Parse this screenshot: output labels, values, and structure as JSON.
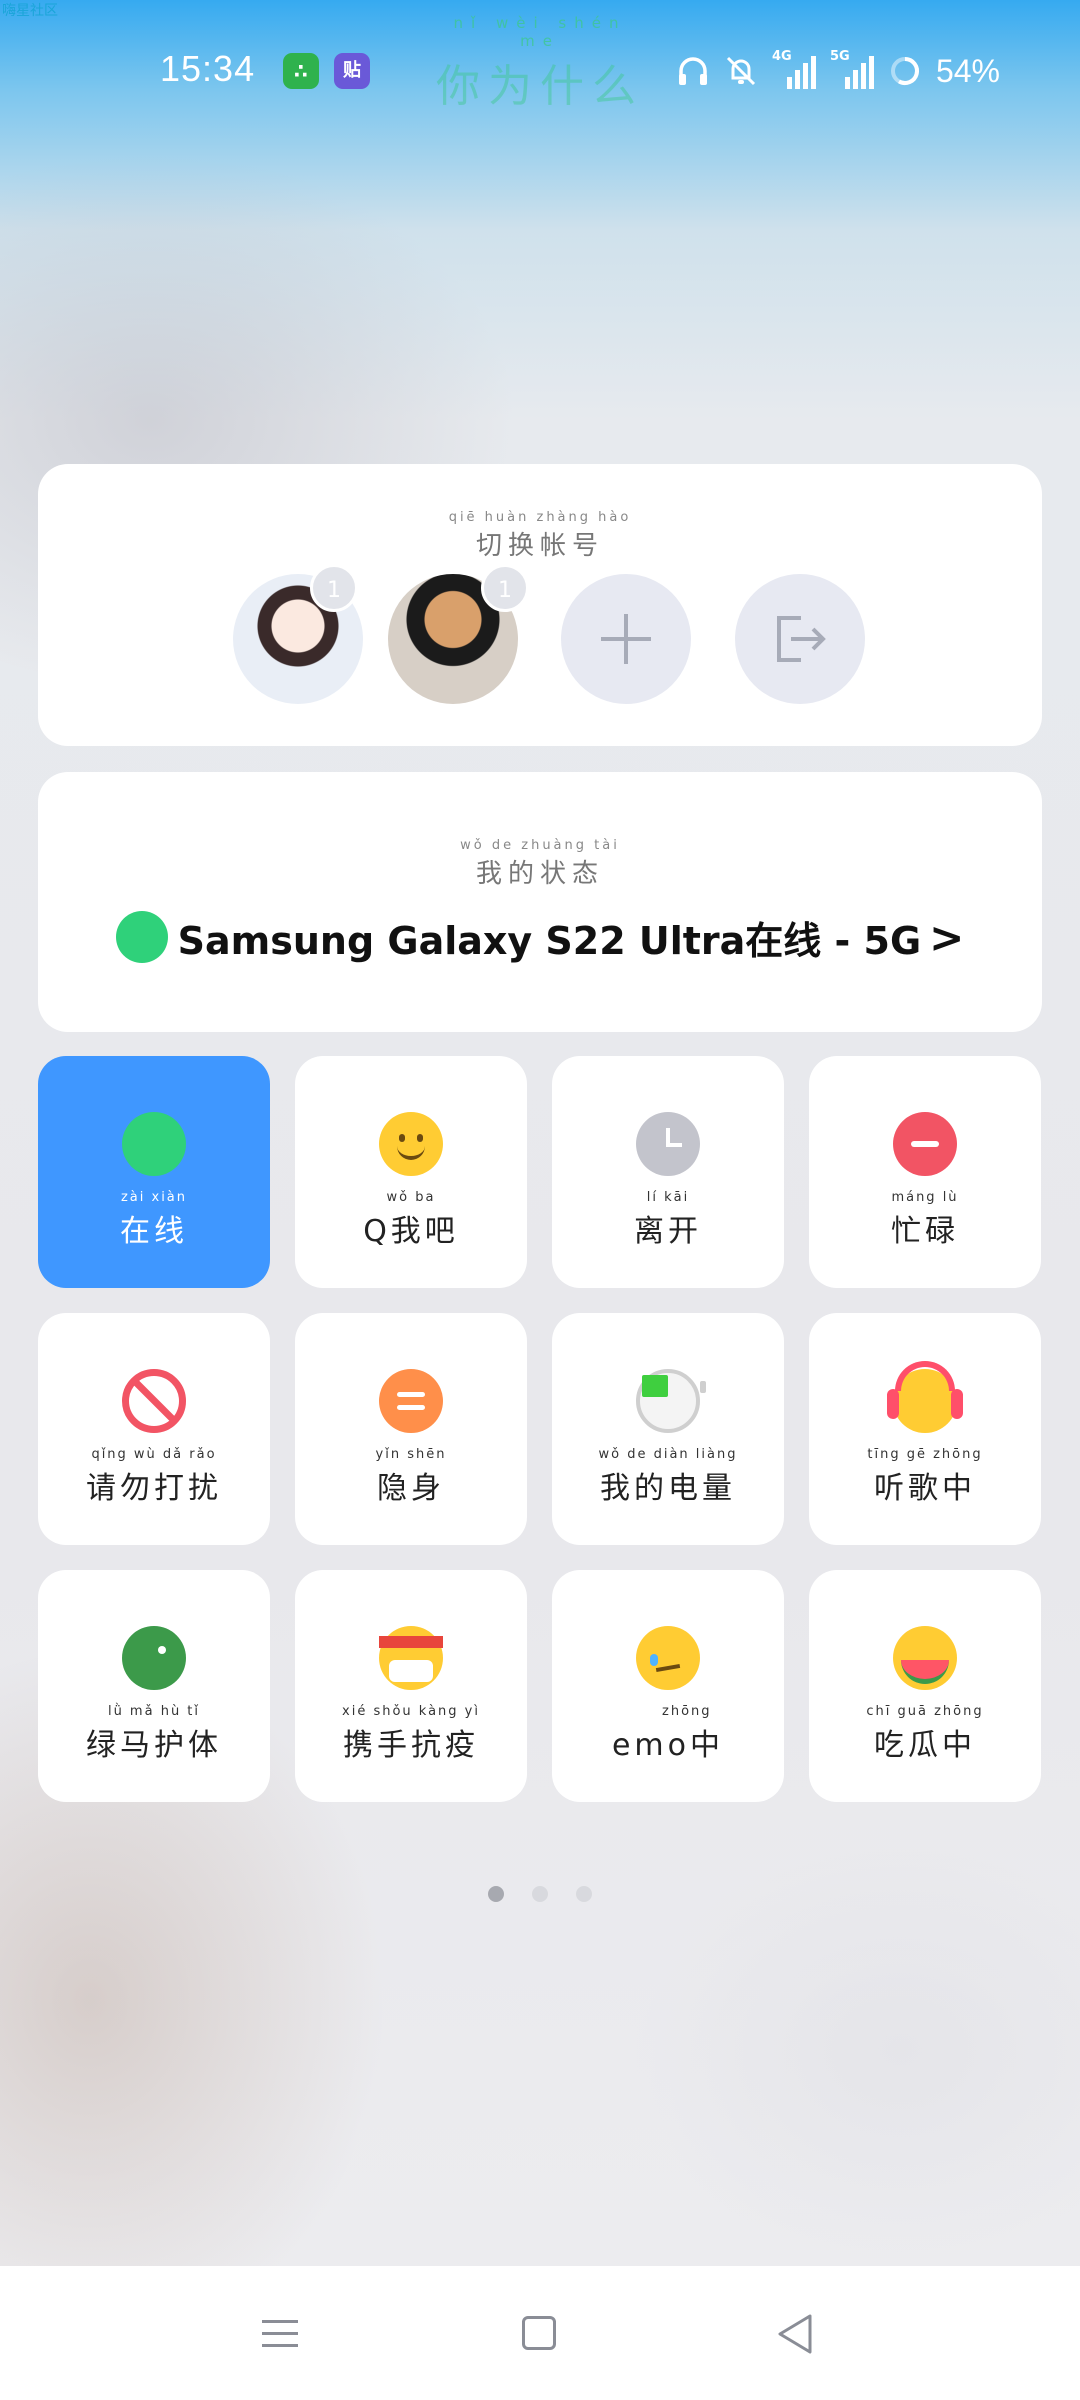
{
  "statusbar": {
    "watermark": "嗨星社区",
    "time": "15:34",
    "app_icon_1": "∴",
    "app_icon_2": "贴",
    "center_title_pinyin": "nǐ wèi shén me",
    "center_title": "你为什么",
    "signal_1_label": "4G",
    "signal_2_label": "5G",
    "battery": "54%",
    "icons": [
      "headphones-icon",
      "bell-muted-icon",
      "signal-4g-icon",
      "signal-5g-icon",
      "battery-ring-icon"
    ]
  },
  "accounts_card": {
    "title_pinyin": "qiē huàn zhàng hào",
    "title": "切换帐号",
    "accounts": [
      {
        "badge": "1"
      },
      {
        "badge": "1"
      }
    ],
    "add_icon": "plus-icon",
    "exit_icon": "logout-icon"
  },
  "status_card": {
    "title_pinyin": "wǒ de zhuàng tài",
    "title": "我的状态",
    "current": "Samsung Galaxy S22 Ultra在线 - 5G",
    "chevron": ">",
    "dot_color": "#2fd17a"
  },
  "tiles": [
    {
      "pinyin": "zài xiàn",
      "label": "在线",
      "icon": "online-dot-icon",
      "active": true
    },
    {
      "pinyin": "wǒ ba",
      "label": "Q我吧",
      "icon": "smile-icon",
      "active": false
    },
    {
      "pinyin": "lí kāi",
      "label": "离开",
      "icon": "clock-icon",
      "active": false
    },
    {
      "pinyin": "máng lù",
      "label": "忙碌",
      "icon": "minus-circle-icon",
      "active": false
    },
    {
      "pinyin": "qǐng wù dǎ rǎo",
      "label": "请勿打扰",
      "icon": "no-entry-icon",
      "active": false
    },
    {
      "pinyin": "yǐn shēn",
      "label": "隐身",
      "icon": "equals-circle-icon",
      "active": false
    },
    {
      "pinyin": "wǒ de diàn liàng",
      "label": "我的电量",
      "icon": "battery-icon",
      "active": false
    },
    {
      "pinyin": "tīng gē zhōng",
      "label": "听歌中",
      "icon": "headphones-emoji-icon",
      "active": false
    },
    {
      "pinyin": "lǜ mǎ hù tǐ",
      "label": "绿马护体",
      "icon": "green-horse-icon",
      "active": false
    },
    {
      "pinyin": "xié shǒu kàng yì",
      "label": "携手抗疫",
      "icon": "mask-emoji-icon",
      "active": false
    },
    {
      "pinyin": "zhōng",
      "label": "emo中",
      "icon": "sad-emoji-icon",
      "active": false
    },
    {
      "pinyin": "chī guā zhōng",
      "label": "吃瓜中",
      "icon": "melon-emoji-icon",
      "active": false
    }
  ],
  "pager": {
    "count": 3,
    "active_index": 0
  },
  "navbar": {
    "icons": [
      "menu-icon",
      "home-square-icon",
      "back-triangle-icon"
    ]
  },
  "colors": {
    "accent": "#3f97ff",
    "online": "#2fd17a",
    "busy": "#f25464"
  }
}
